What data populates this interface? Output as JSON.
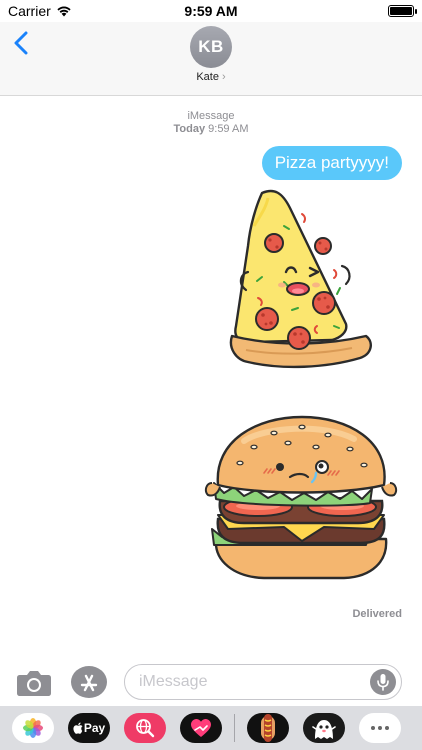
{
  "status_bar": {
    "carrier": "Carrier",
    "time": "9:59 AM"
  },
  "header": {
    "back_icon": "chevron-left-icon",
    "avatar_initials": "KB",
    "contact_name": "Kate",
    "contact_chevron": "›"
  },
  "conversation": {
    "service": "iMessage",
    "day": "Today",
    "time": "9:59 AM",
    "sent_message": "Pizza partyyyy!",
    "stickers": [
      "pizza-sticker",
      "burger-sticker"
    ],
    "delivery_status": "Delivered"
  },
  "input": {
    "placeholder": "iMessage"
  },
  "app_drawer": {
    "apps": [
      "photos",
      "apple-pay",
      "images-search",
      "digital-touch",
      "hotdog-stickers",
      "ghost-stickers",
      "more"
    ],
    "pay_label": "Pay"
  },
  "colors": {
    "bubble_blue": "#5ac8fa",
    "ios_blue": "#1a82fb",
    "gray_text": "#8e8e93"
  }
}
